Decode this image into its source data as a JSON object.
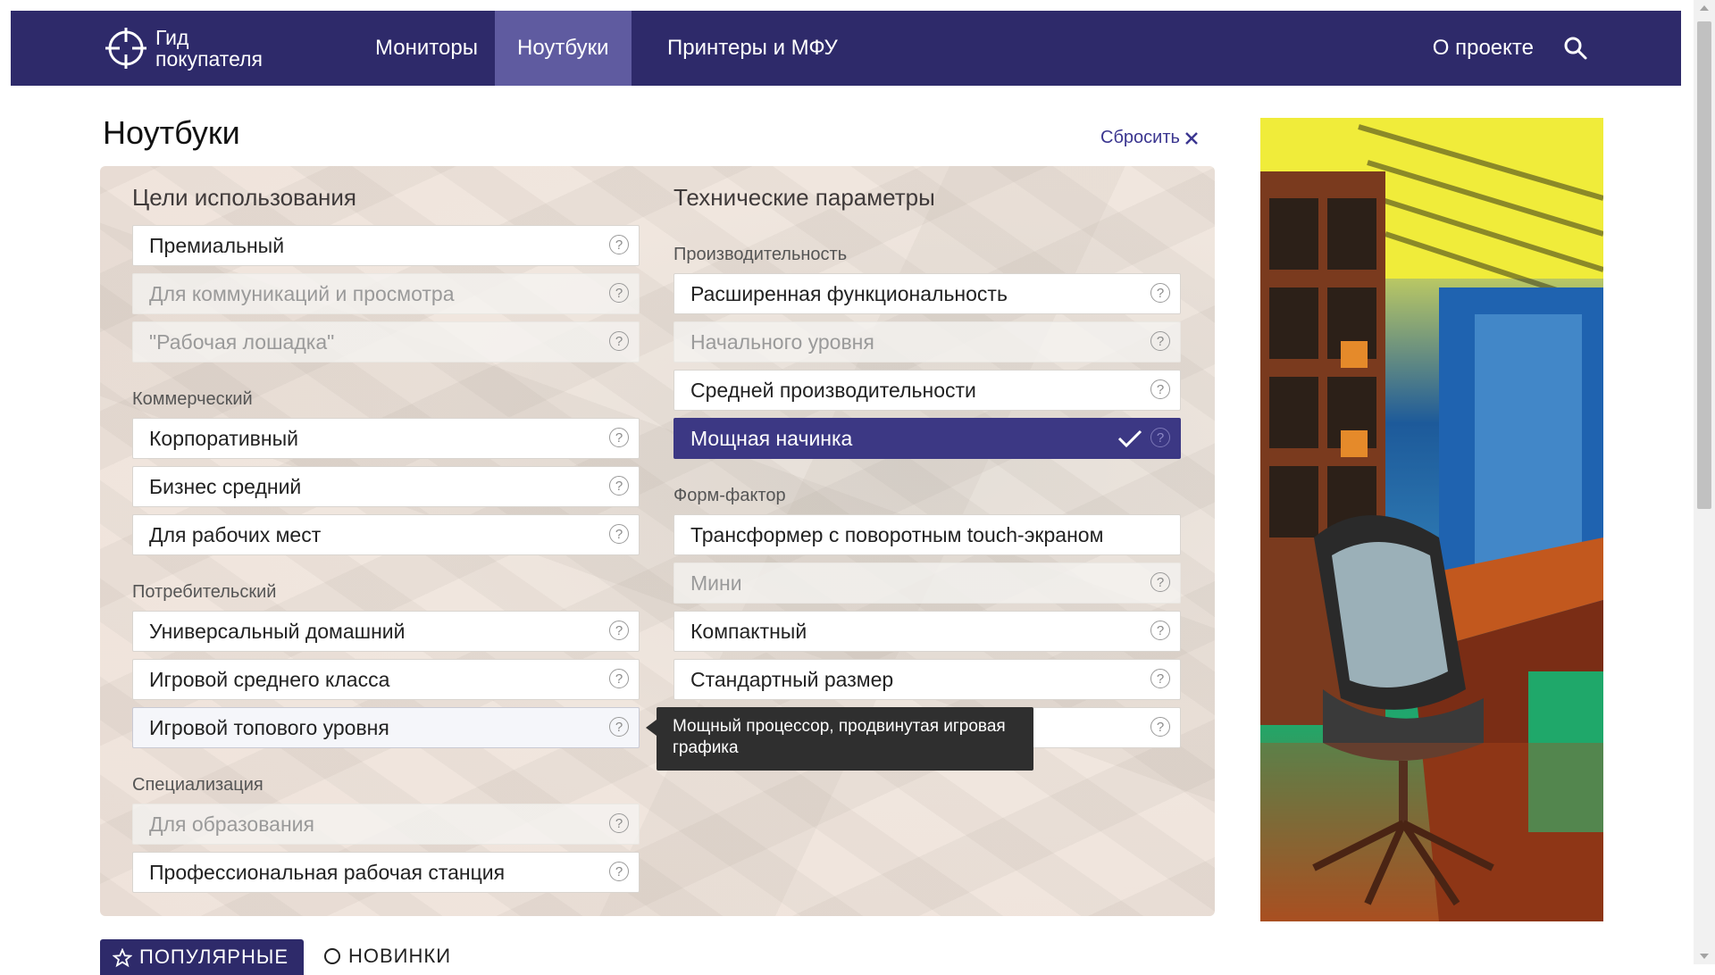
{
  "header": {
    "logo_line1": "Гид",
    "logo_line2": "покупателя",
    "nav": [
      "Мониторы",
      "Ноутбуки",
      "Принтеры и МФУ"
    ],
    "active_nav": "Ноутбуки",
    "about": "О проекте",
    "brand_color": "#2e2a6a",
    "active_color": "#5f5ba0"
  },
  "page": {
    "title": "Ноутбуки",
    "reset": "Сбросить"
  },
  "usage": {
    "title": "Цели использования",
    "top_options": [
      "Премиальный",
      "Для коммуникаций и просмотра",
      "\"Рабочая лошадка\""
    ],
    "commercial_label": "Коммерческий",
    "commercial_options": [
      "Корпоративный",
      "Бизнес средний",
      "Для рабочих мест"
    ],
    "consumer_label": "Потребительский",
    "consumer_options": [
      "Универсальный домашний",
      "Игровой среднего класса",
      "Игровой топового уровня"
    ],
    "special_label": "Специализация",
    "special_options": [
      "Для образования",
      "Профессиональная рабочая станция"
    ]
  },
  "tech": {
    "title": "Технические параметры",
    "perf_label": "Производительность",
    "perf_options": [
      "Расширенная функциональность",
      "Начального уровня",
      "Средней производительности",
      "Мощная начинка"
    ],
    "form_label": "Форм-фактор",
    "form_options": [
      "Трансформер с поворотным touch-экраном",
      "Мини",
      "Компактный",
      "Стандартный размер"
    ]
  },
  "help_glyph": "?",
  "tooltip": "Мощный процессор, продвинутая игровая графика",
  "tabs": {
    "popular": "ПОПУЛЯРНЫЕ",
    "new": "НОВИНКИ"
  },
  "selected_color": "#3c3884"
}
